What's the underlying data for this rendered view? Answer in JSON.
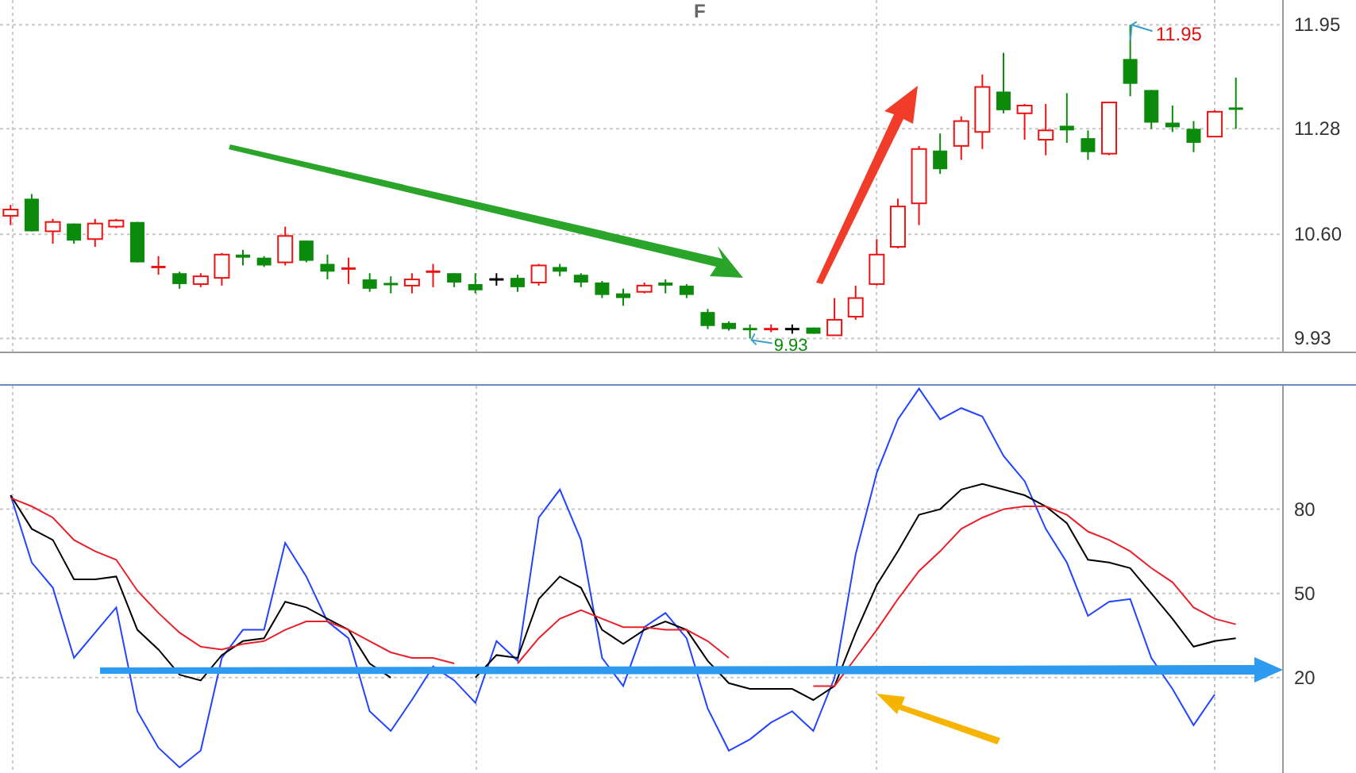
{
  "price_panel": {
    "top_label": "F",
    "chart_data": {
      "type": "candlestick",
      "grid": true,
      "ylim": [
        9.84,
        12.11
      ],
      "yticks": [
        {
          "value": 11.95,
          "label": "11.95"
        },
        {
          "value": 11.28,
          "label": "11.28"
        },
        {
          "value": 10.6,
          "label": "10.60"
        },
        {
          "value": 9.93,
          "label": "9.93"
        }
      ],
      "categories": [
        null,
        null,
        null,
        null,
        null,
        null,
        null,
        null,
        null,
        null,
        null,
        null,
        null,
        null,
        null,
        null,
        null,
        null,
        null,
        null,
        null,
        null,
        null,
        null,
        null,
        null,
        null,
        null,
        null,
        null,
        null,
        null,
        null,
        null,
        null,
        null,
        null,
        null,
        null,
        null,
        null,
        null,
        null,
        null,
        null,
        null,
        null,
        null,
        null,
        null,
        null,
        null,
        null,
        null,
        null,
        null,
        null,
        null,
        null
      ],
      "ohlc": [
        [
          10.72,
          10.79,
          10.66,
          10.76
        ],
        [
          10.83,
          10.86,
          10.62,
          10.62
        ],
        [
          10.62,
          10.7,
          10.54,
          10.68
        ],
        [
          10.67,
          10.67,
          10.54,
          10.56
        ],
        [
          10.57,
          10.7,
          10.52,
          10.67
        ],
        [
          10.65,
          10.7,
          10.64,
          10.69
        ],
        [
          10.68,
          10.68,
          10.42,
          10.42
        ],
        [
          10.38,
          10.46,
          10.34,
          10.39
        ],
        [
          10.35,
          10.36,
          10.25,
          10.28
        ],
        [
          10.28,
          10.35,
          10.26,
          10.33
        ],
        [
          10.32,
          10.48,
          10.27,
          10.47
        ],
        [
          10.47,
          10.5,
          10.4,
          10.45
        ],
        [
          10.45,
          10.46,
          10.39,
          10.4
        ],
        [
          10.42,
          10.65,
          10.4,
          10.59
        ],
        [
          10.56,
          10.56,
          10.42,
          10.43
        ],
        [
          10.41,
          10.47,
          10.31,
          10.36
        ],
        [
          10.37,
          10.45,
          10.28,
          10.38
        ],
        [
          10.31,
          10.35,
          10.23,
          10.25
        ],
        [
          10.28,
          10.33,
          10.22,
          10.27
        ],
        [
          10.27,
          10.35,
          10.22,
          10.31
        ],
        [
          10.35,
          10.41,
          10.26,
          10.36
        ],
        [
          10.35,
          10.35,
          10.26,
          10.29
        ],
        [
          10.28,
          10.35,
          10.22,
          10.24
        ],
        [
          10.31,
          10.35,
          10.27,
          10.31
        ],
        [
          10.32,
          10.34,
          10.23,
          10.26
        ],
        [
          10.29,
          10.41,
          10.27,
          10.4
        ],
        [
          10.39,
          10.41,
          10.33,
          10.36
        ],
        [
          10.34,
          10.35,
          10.26,
          10.29
        ],
        [
          10.29,
          10.3,
          10.19,
          10.21
        ],
        [
          10.22,
          10.25,
          10.14,
          10.19
        ],
        [
          10.23,
          10.29,
          10.22,
          10.27
        ],
        [
          10.29,
          10.31,
          10.22,
          10.27
        ],
        [
          10.27,
          10.28,
          10.19,
          10.21
        ],
        [
          10.1,
          10.12,
          9.99,
          10.01
        ],
        [
          10.03,
          10.04,
          9.98,
          9.99
        ],
        [
          9.99,
          10.02,
          9.93,
          9.98
        ],
        [
          9.98,
          10.02,
          9.97,
          9.99
        ],
        [
          9.99,
          10.02,
          9.96,
          9.99
        ],
        [
          10.0,
          10.0,
          9.96,
          9.96
        ],
        [
          9.95,
          10.19,
          9.95,
          10.05
        ],
        [
          10.07,
          10.27,
          10.05,
          10.19
        ],
        [
          10.28,
          10.57,
          10.27,
          10.47
        ],
        [
          10.52,
          10.83,
          10.51,
          10.78
        ],
        [
          10.8,
          11.17,
          10.66,
          11.15
        ],
        [
          11.14,
          11.25,
          10.99,
          11.02
        ],
        [
          11.17,
          11.36,
          11.08,
          11.33
        ],
        [
          11.26,
          11.63,
          11.15,
          11.55
        ],
        [
          11.52,
          11.77,
          11.38,
          11.4
        ],
        [
          11.38,
          11.44,
          11.21,
          11.43
        ],
        [
          11.21,
          11.44,
          11.11,
          11.27
        ],
        [
          11.3,
          11.51,
          11.19,
          11.27
        ],
        [
          11.22,
          11.27,
          11.08,
          11.13
        ],
        [
          11.12,
          11.45,
          11.11,
          11.45
        ],
        [
          11.73,
          11.95,
          11.49,
          11.57
        ],
        [
          11.53,
          11.53,
          11.28,
          11.32
        ],
        [
          11.32,
          11.43,
          11.26,
          11.29
        ],
        [
          11.28,
          11.33,
          11.13,
          11.19
        ],
        [
          11.23,
          11.4,
          11.23,
          11.39
        ],
        [
          11.41,
          11.61,
          11.28,
          11.4
        ]
      ],
      "annotations": [
        "11.95",
        "9.93"
      ]
    }
  },
  "indicator_panel": {
    "chart_data": {
      "type": "line",
      "grid": true,
      "ylim": [
        -14,
        124
      ],
      "yticks": [
        20,
        50,
        80
      ],
      "categories": [
        null,
        null,
        null,
        null,
        null,
        null,
        null,
        null,
        null,
        null,
        null,
        null,
        null,
        null,
        null,
        null,
        null,
        null,
        null,
        null,
        null,
        null,
        null,
        null,
        null,
        null,
        null,
        null,
        null,
        null,
        null,
        null,
        null,
        null,
        null,
        null,
        null,
        null,
        null,
        null,
        null,
        null,
        null,
        null,
        null,
        null,
        null,
        null,
        null,
        null,
        null,
        null,
        null,
        null,
        null,
        null,
        null,
        null,
        null
      ],
      "series": [
        {
          "color": "#2244ff",
          "values": [
            85,
            61,
            52,
            27,
            36,
            45,
            8,
            -5,
            -12,
            -6,
            27,
            37,
            37,
            68,
            56,
            40,
            34,
            8,
            1,
            12,
            24,
            19,
            11,
            33,
            26,
            77,
            87,
            69,
            27,
            17,
            38,
            43,
            34,
            9,
            -6,
            -2,
            4,
            8,
            1,
            20,
            64,
            93,
            112,
            123,
            112,
            116,
            113,
            99,
            90,
            73,
            61,
            42,
            47,
            48,
            27,
            16,
            3,
            14,
            null
          ]
        },
        {
          "color": "#000000",
          "values": [
            85,
            73,
            69,
            55,
            55,
            56,
            37,
            30,
            21,
            19,
            28,
            33,
            34,
            47,
            45,
            41,
            37,
            25,
            20,
            null,
            null,
            null,
            20,
            28,
            27,
            48,
            56,
            52,
            37,
            32,
            37,
            40,
            37,
            26,
            18,
            16,
            16,
            16,
            12,
            17,
            36,
            53,
            65,
            78,
            80,
            87,
            89,
            87,
            85,
            81,
            75,
            62,
            61,
            59,
            50,
            41,
            31,
            33,
            34
          ]
        },
        {
          "color": "#e8202a",
          "values": [
            84,
            81,
            77,
            69,
            65,
            62,
            51,
            43,
            36,
            31,
            30,
            32,
            33,
            37,
            40,
            40,
            37,
            33,
            29,
            27,
            27,
            25,
            null,
            null,
            25,
            34,
            41,
            44,
            41,
            38,
            38,
            37,
            37,
            33,
            27,
            null,
            null,
            null,
            17,
            17,
            27,
            37,
            48,
            58,
            65,
            73,
            77,
            80,
            81,
            81,
            78,
            72,
            69,
            65,
            59,
            54,
            45,
            41,
            39
          ]
        }
      ]
    }
  }
}
